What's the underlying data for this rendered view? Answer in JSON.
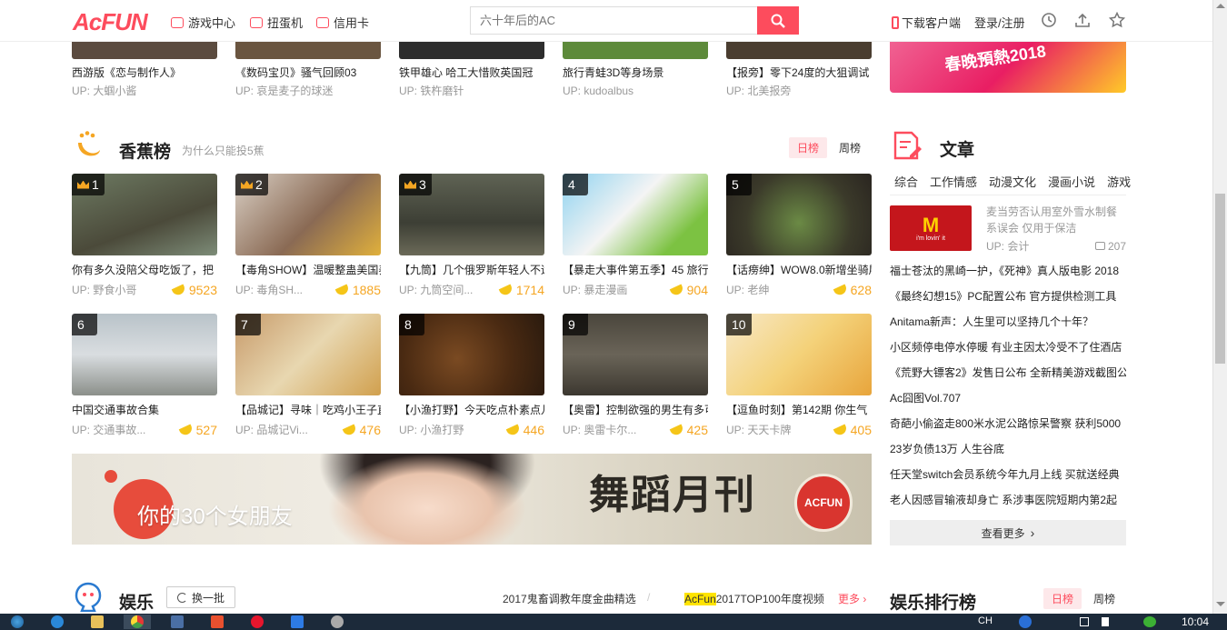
{
  "header": {
    "logo": "AcFUN",
    "nav": [
      {
        "label": "游戏中心",
        "icon": "gamepad-icon"
      },
      {
        "label": "扭蛋机",
        "icon": "capsule-icon"
      },
      {
        "label": "信用卡",
        "icon": "card-icon"
      }
    ],
    "search_placeholder": "六十年后的AC",
    "download": "下载客户端",
    "login": "登录/注册"
  },
  "top_strip": [
    {
      "title": "西游版《恋与制作人》",
      "up": "UP:  大蝈小酱"
    },
    {
      "title": "《数码宝贝》骚气回顾03",
      "up": "UP:  哀是麦子的球迷"
    },
    {
      "title": "铁甲雄心  哈工大惜败英国冠",
      "up": "UP:  铁杵磨针"
    },
    {
      "title": "旅行青蛙3D等身场景",
      "up": "UP:  kudoalbus"
    },
    {
      "title": "【报旁】零下24度的大狙调试",
      "up": "UP:  北美报旁"
    }
  ],
  "top_banner_text": "春晚預熱2018",
  "banana_section": {
    "title": "香蕉榜",
    "subtitle": "为什么只能投5蕉",
    "tab_day": "日榜",
    "tab_week": "周榜",
    "items": [
      {
        "rank": "1",
        "title": "你有多久没陪父母吃饭了，把",
        "up": "UP:  野食小哥",
        "bananas": "9523",
        "crown": true
      },
      {
        "rank": "2",
        "title": "【毒角SHOW】温暖整蛊美国养",
        "up": "UP:  毒角SH...",
        "bananas": "1885",
        "crown": true
      },
      {
        "rank": "3",
        "title": "【九筒】几个俄罗斯年轻人不远",
        "up": "UP:  九筒空间...",
        "bananas": "1714",
        "crown": true
      },
      {
        "rank": "4",
        "title": "【暴走大事件第五季】45  旅行",
        "up": "UP:  暴走漫画",
        "bananas": "904",
        "crown": false
      },
      {
        "rank": "5",
        "title": "【话痨绅】WOW8.0新增坐骑展",
        "up": "UP:  老绅",
        "bananas": "628",
        "crown": false
      },
      {
        "rank": "6",
        "title": "中国交通事故合集",
        "up": "UP:  交通事故...",
        "bananas": "527",
        "crown": false
      },
      {
        "rank": "7",
        "title": "【品城记】寻味｜吃鸡小王子直",
        "up": "UP:  品城记Vi...",
        "bananas": "476",
        "crown": false
      },
      {
        "rank": "8",
        "title": "【小渔打野】今天吃点朴素点儿",
        "up": "UP:  小渔打野",
        "bananas": "446",
        "crown": false
      },
      {
        "rank": "9",
        "title": "【奥雷】控制欲强的男生有多可",
        "up": "UP:  奥雷卡尔...",
        "bananas": "425",
        "crown": false
      },
      {
        "rank": "10",
        "title": "【逗鱼时刻】第142期  你生气",
        "up": "UP:  天天卡牌",
        "bananas": "405",
        "crown": false
      }
    ]
  },
  "big_banner": {
    "left_text": "你的30个女朋友",
    "right_text": "舞蹈月刊",
    "seal": "ACFUN"
  },
  "articles": {
    "title": "文章",
    "tabs": [
      "综合",
      "工作情感",
      "动漫文化",
      "漫画小说",
      "游戏"
    ],
    "feature": {
      "logo": "M",
      "logo_sub": "i'm lovin' it",
      "text": "麦当劳否认用室外雪水制餐系误会  仅用于保洁",
      "up": "UP:  会计",
      "comments": "207"
    },
    "list": [
      "福士苍汰的黑崎一护，《死神》真人版电影  2018",
      "《最终幻想15》PC配置公布  官方提供检测工具",
      "Anitama新声：人生里可以坚持几个十年？",
      "小区频停电停水停暖  有业主因太冷受不了住酒店",
      "《荒野大镖客2》发售日公布  全新精美游戏截图公",
      "Ac囧图Vol.707",
      "奇葩小偷盗走800米水泥公路惊呆警察  获利5000",
      "23岁负债13万  人生谷底",
      "任天堂switch会员系统今年九月上线  买就送经典",
      "老人因感冒输液却身亡  系涉事医院短期内第2起"
    ],
    "more": "查看更多"
  },
  "bottom": {
    "title": "娱乐",
    "swap": "换一批",
    "link1": "2017鬼畜调教年度金曲精选",
    "link2_hl": "AcFun",
    "link2": "2017TOP100年度视频",
    "more": "更多",
    "rank_title": "娱乐排行榜",
    "tab_day": "日榜",
    "tab_week": "周榜"
  },
  "taskbar": {
    "lang": "CH",
    "clock": "10:04"
  }
}
